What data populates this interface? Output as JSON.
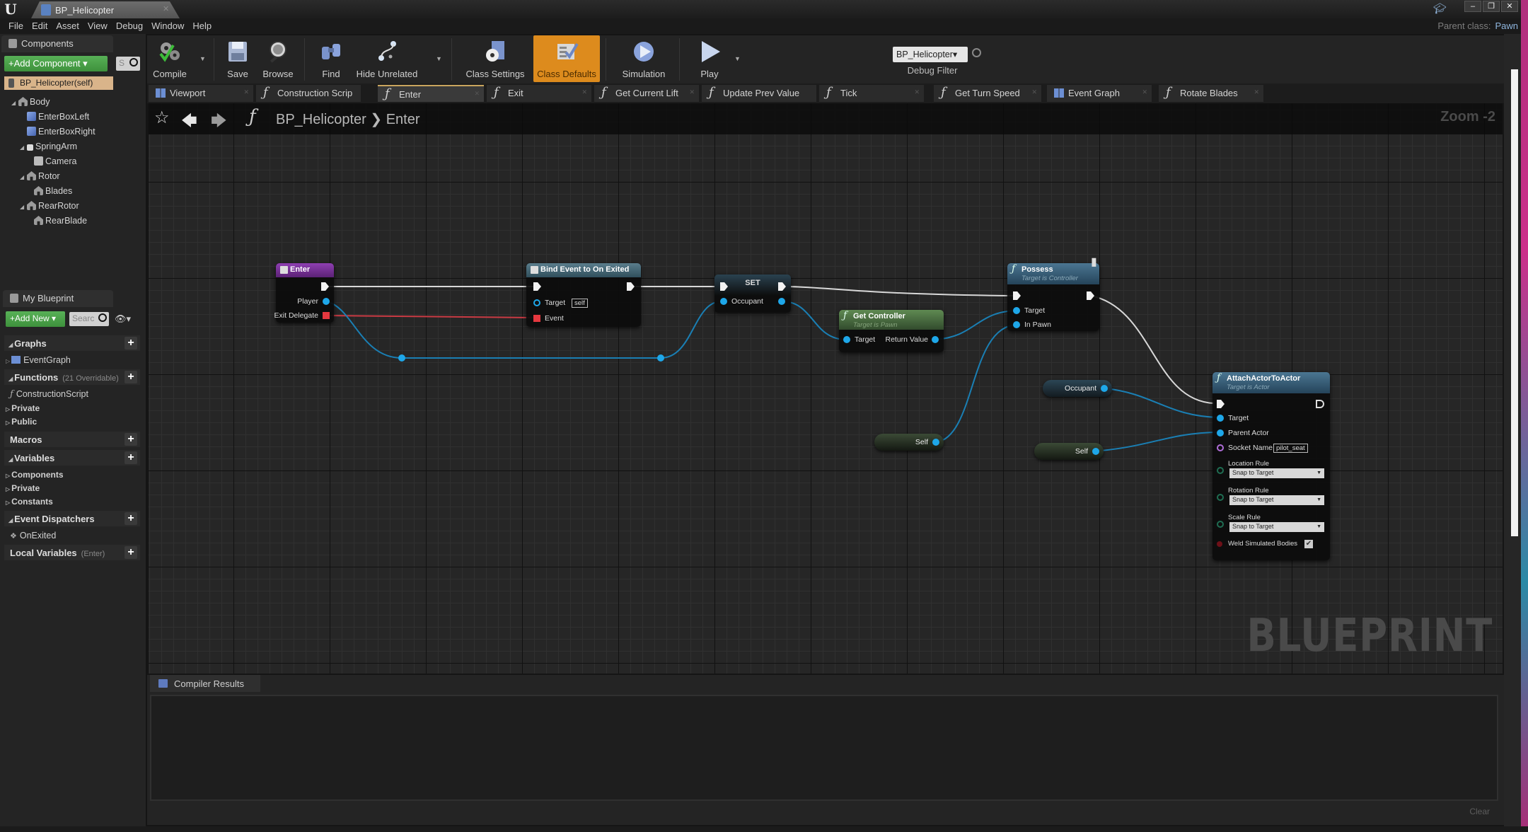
{
  "window": {
    "tab_title": "BP_Helicopter",
    "parent_class_label": "Parent class:",
    "parent_class_value": "Pawn"
  },
  "menu": [
    "File",
    "Edit",
    "Asset",
    "View",
    "Debug",
    "Window",
    "Help"
  ],
  "components_panel": {
    "tab_label": "Components",
    "add_button": "+Add Component ▾",
    "search_placeholder": "S",
    "self_item": "BP_Helicopter(self)",
    "tree": [
      {
        "label": "Body",
        "icon": "scene-icon",
        "depth": 0,
        "expanded": true
      },
      {
        "label": "EnterBoxLeft",
        "icon": "box-collision-icon",
        "depth": 1
      },
      {
        "label": "EnterBoxRight",
        "icon": "box-collision-icon",
        "depth": 1
      },
      {
        "label": "SpringArm",
        "icon": "spring-arm-icon",
        "depth": 1,
        "expanded": true
      },
      {
        "label": "Camera",
        "icon": "camera-icon",
        "depth": 2
      },
      {
        "label": "Rotor",
        "icon": "scene-icon",
        "depth": 1,
        "expanded": true
      },
      {
        "label": "Blades",
        "icon": "scene-icon",
        "depth": 2
      },
      {
        "label": "RearRotor",
        "icon": "scene-icon",
        "depth": 1,
        "expanded": true
      },
      {
        "label": "RearBlade",
        "icon": "scene-icon",
        "depth": 2
      }
    ]
  },
  "my_blueprint": {
    "tab_label": "My Blueprint",
    "add_button": "+Add New ▾",
    "search_placeholder": "Searc",
    "sections": {
      "graphs": {
        "label": "Graphs",
        "items": [
          "EventGraph"
        ]
      },
      "functions": {
        "label": "Functions",
        "sub": "(21 Overridable)",
        "items": [
          "ConstructionScript"
        ],
        "groups": [
          "Private",
          "Public"
        ]
      },
      "macros": {
        "label": "Macros"
      },
      "variables": {
        "label": "Variables",
        "groups": [
          "Components",
          "Private",
          "Constants"
        ]
      },
      "event_dispatchers": {
        "label": "Event Dispatchers",
        "items": [
          "OnExited"
        ]
      },
      "local_variables": {
        "label": "Local Variables",
        "sub": "(Enter)"
      }
    }
  },
  "toolbar": {
    "compile": "Compile",
    "save": "Save",
    "browse": "Browse",
    "find": "Find",
    "hide_unrelated": "Hide Unrelated",
    "class_settings": "Class Settings",
    "class_defaults": "Class Defaults",
    "simulation": "Simulation",
    "play": "Play",
    "debug_select": "BP_Helicopter▾",
    "debug_filter": "Debug Filter"
  },
  "graph_tabs": [
    {
      "label": "Viewport",
      "icon": "viewport-icon"
    },
    {
      "label": "Construction Scrip",
      "icon": "function-icon"
    },
    {
      "label": "Enter",
      "icon": "function-icon",
      "active": true
    },
    {
      "label": "Exit",
      "icon": "function-icon"
    },
    {
      "label": "Get Current Lift",
      "icon": "function-icon"
    },
    {
      "label": "Update Prev Value",
      "icon": "function-icon"
    },
    {
      "label": "Tick",
      "icon": "function-icon"
    },
    {
      "label": "Get Turn Speed",
      "icon": "function-icon"
    },
    {
      "label": "Event Graph",
      "icon": "event-graph-icon"
    },
    {
      "label": "Rotate Blades",
      "icon": "function-icon"
    }
  ],
  "breadcrumb": {
    "path": "BP_Helicopter ❯ Enter",
    "zoom": "Zoom -2"
  },
  "watermark": "BLUEPRINT",
  "nodes": {
    "enter": {
      "title": "Enter",
      "pins": [
        "Player",
        "Exit Delegate"
      ]
    },
    "bind": {
      "title": "Bind Event to On Exited",
      "pins": [
        "Target",
        "Event"
      ],
      "target_default": "self"
    },
    "set": {
      "title": "SET",
      "pins": [
        "Occupant"
      ]
    },
    "get_controller": {
      "title": "Get Controller",
      "subtitle": "Target is Pawn",
      "pins": [
        "Target",
        "Return Value"
      ]
    },
    "possess": {
      "title": "Possess",
      "subtitle": "Target is Controller",
      "pins": [
        "Target",
        "In Pawn"
      ]
    },
    "attach": {
      "title": "AttachActorToActor",
      "subtitle": "Target is Actor",
      "pins": [
        "Target",
        "Parent Actor",
        "Socket Name",
        "Location Rule",
        "Rotation Rule",
        "Scale Rule",
        "Weld Simulated Bodies"
      ],
      "socket_name": "pilot_seat",
      "location_rule": "Snap to Target",
      "rotation_rule": "Snap to Target",
      "scale_rule": "Snap to Target",
      "weld_simulated_bodies": true
    },
    "var_occupant": {
      "label": "Occupant"
    },
    "self_1": {
      "label": "Self"
    },
    "self_2": {
      "label": "Self"
    }
  },
  "compiler": {
    "tab_label": "Compiler Results",
    "clear": "Clear"
  },
  "colors": {
    "object_pin": "#1ea7e9",
    "delegate_pin": "#e5383f",
    "exec_wire": "#d8d8d8",
    "class_defaults_accent": "#dd8b1d",
    "add_button_green": "#4ca34a"
  }
}
